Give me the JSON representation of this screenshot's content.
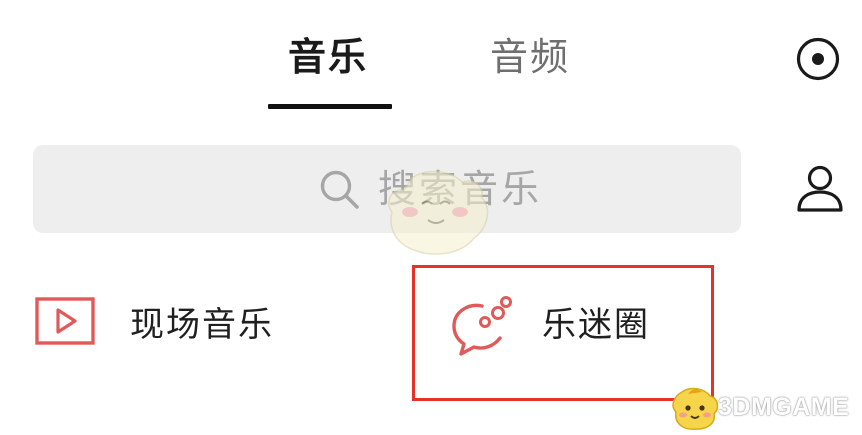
{
  "tabs": {
    "music": "音乐",
    "audio": "音频"
  },
  "search": {
    "placeholder": "搜索音乐"
  },
  "entries": {
    "live_music": "现场音乐",
    "fan_circle": "乐迷圈"
  },
  "icons": {
    "radio": "radio-icon",
    "search": "search-icon",
    "profile": "profile-icon",
    "live_music": "play-video-icon",
    "fan_circle": "chat-bubbles-icon"
  },
  "colors": {
    "accent": "#e05a5a",
    "highlight": "#e5332a",
    "search_bg": "#eeeeee"
  },
  "watermark": {
    "brand": "3DMGAME"
  }
}
